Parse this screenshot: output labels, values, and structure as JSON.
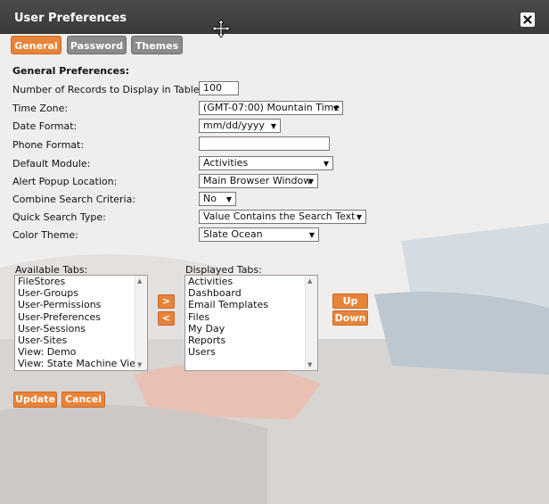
{
  "window": {
    "title": "User Preferences"
  },
  "tabs": [
    {
      "label": "General",
      "active": true
    },
    {
      "label": "Password",
      "active": false
    },
    {
      "label": "Themes",
      "active": false
    }
  ],
  "section_title": "General Preferences:",
  "fields": {
    "records": {
      "label": "Number of Records to Display in Table:",
      "value": "100"
    },
    "timezone": {
      "label": "Time Zone:",
      "value": "(GMT-07:00) Mountain Time"
    },
    "date_format": {
      "label": "Date Format:",
      "value": "mm/dd/yyyy"
    },
    "phone_format": {
      "label": "Phone Format:",
      "value": ""
    },
    "default_module": {
      "label": "Default Module:",
      "value": "Activities"
    },
    "alert_popup": {
      "label": "Alert Popup Location:",
      "value": "Main Browser Window"
    },
    "combine_search": {
      "label": "Combine Search Criteria:",
      "value": "No"
    },
    "quick_search": {
      "label": "Quick Search Type:",
      "value": "Value Contains the Search Text"
    },
    "color_theme": {
      "label": "Color Theme:",
      "value": "Slate Ocean"
    }
  },
  "available_tabs": {
    "label": "Available Tabs:",
    "items": [
      "FileStores",
      "User-Groups",
      "User-Permissions",
      "User-Preferences",
      "User-Sessions",
      "User-Sites",
      "View: Demo",
      "View: State Machine View"
    ]
  },
  "displayed_tabs": {
    "label": "Displayed Tabs:",
    "items": [
      "Activities",
      "Dashboard",
      "Email Templates",
      "Files",
      "My Day",
      "Reports",
      "Users"
    ]
  },
  "buttons": {
    "move_right": ">",
    "move_left": "<",
    "up": "Up",
    "down": "Down",
    "update": "Update",
    "cancel": "Cancel"
  },
  "icons": {
    "close": "close-icon",
    "move": "move-icon"
  },
  "colors": {
    "accent": "#e8833a",
    "titlebar": "#3f3f3f",
    "inactive_tab": "#8b8b8b"
  }
}
